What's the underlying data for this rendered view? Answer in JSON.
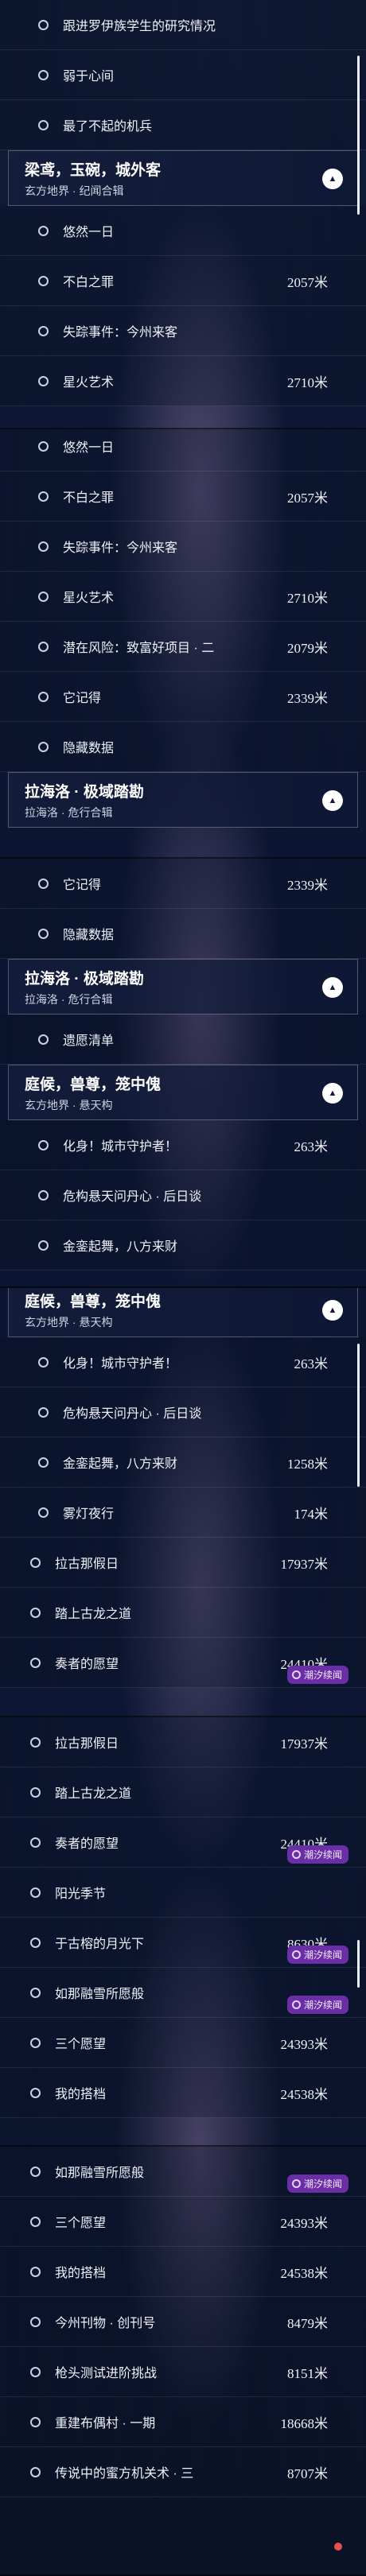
{
  "segments": [
    {
      "rows": [
        {
          "kind": "item",
          "indent": true,
          "label": "跟进罗伊族学生的研究情况"
        },
        {
          "kind": "item",
          "indent": true,
          "label": "弱于心间"
        },
        {
          "kind": "item",
          "indent": true,
          "label": "最了不起的机兵"
        },
        {
          "kind": "header",
          "title": "梁鸢，玉碗，城外客",
          "sub": "玄方地界 · 纪闻合辑"
        },
        {
          "kind": "item",
          "indent": true,
          "label": "悠然一日"
        },
        {
          "kind": "item",
          "indent": true,
          "label": "不白之罪",
          "dist": "2057米"
        },
        {
          "kind": "item",
          "indent": true,
          "label": "失踪事件：今州来客"
        },
        {
          "kind": "item",
          "indent": true,
          "label": "星火艺术",
          "dist": "2710米"
        }
      ]
    },
    {
      "rows": [
        {
          "kind": "item",
          "indent": true,
          "label": "悠然一日"
        },
        {
          "kind": "item",
          "indent": true,
          "label": "不白之罪",
          "dist": "2057米"
        },
        {
          "kind": "item",
          "indent": true,
          "label": "失踪事件：今州来客"
        },
        {
          "kind": "item",
          "indent": true,
          "label": "星火艺术",
          "dist": "2710米"
        },
        {
          "kind": "item",
          "indent": true,
          "label": "潜在风险：致富好项目 · 二",
          "dist": "2079米"
        },
        {
          "kind": "item",
          "indent": true,
          "label": "它记得",
          "dist": "2339米"
        },
        {
          "kind": "item",
          "indent": true,
          "label": "隐藏数据"
        },
        {
          "kind": "header",
          "title": "拉海洛 · 极域踏勘",
          "sub": "拉海洛 · 危行合辑"
        }
      ]
    },
    {
      "rows": [
        {
          "kind": "item",
          "indent": true,
          "label": "它记得",
          "dist": "2339米"
        },
        {
          "kind": "item",
          "indent": true,
          "label": "隐藏数据"
        },
        {
          "kind": "header",
          "title": "拉海洛 · 极域踏勘",
          "sub": "拉海洛 · 危行合辑"
        },
        {
          "kind": "item",
          "indent": true,
          "label": "遗愿清单"
        },
        {
          "kind": "header",
          "title": "庭候，兽尊，笼中傀",
          "sub": "玄方地界 · 悬天构"
        },
        {
          "kind": "item",
          "indent": true,
          "label": "化身！城市守护者！",
          "dist": "263米"
        },
        {
          "kind": "item",
          "indent": true,
          "label": "危构悬天问丹心 · 后日谈"
        },
        {
          "kind": "item",
          "indent": true,
          "label": "金銮起舞，八方来财"
        }
      ]
    },
    {
      "rows": [
        {
          "kind": "header",
          "title": "庭候，兽尊，笼中傀",
          "sub": "玄方地界 · 悬天构"
        },
        {
          "kind": "item",
          "indent": true,
          "label": "化身！城市守护者！",
          "dist": "263米"
        },
        {
          "kind": "item",
          "indent": true,
          "label": "危构悬天问丹心 · 后日谈"
        },
        {
          "kind": "item",
          "indent": true,
          "label": "金銮起舞，八方来财",
          "dist": "1258米"
        },
        {
          "kind": "item",
          "indent": true,
          "label": "雾灯夜行",
          "dist": "174米"
        },
        {
          "kind": "item",
          "indent": false,
          "label": "拉古那假日",
          "dist": "17937米"
        },
        {
          "kind": "item",
          "indent": false,
          "label": "踏上古龙之道"
        },
        {
          "kind": "item",
          "indent": false,
          "label": "奏者的愿望",
          "dist": "24410米",
          "badge": "潮汐续闻"
        }
      ]
    },
    {
      "rows": [
        {
          "kind": "item",
          "indent": false,
          "label": "拉古那假日",
          "dist": "17937米"
        },
        {
          "kind": "item",
          "indent": false,
          "label": "踏上古龙之道"
        },
        {
          "kind": "item",
          "indent": false,
          "label": "奏者的愿望",
          "dist": "24410米",
          "badge": "潮汐续闻"
        },
        {
          "kind": "item",
          "indent": false,
          "label": "阳光季节"
        },
        {
          "kind": "item",
          "indent": false,
          "label": "于古榕的月光下",
          "dist": "8630米",
          "badge": "潮汐续闻"
        },
        {
          "kind": "item",
          "indent": false,
          "label": "如那融雪所愿般",
          "badge": "潮汐续闻"
        },
        {
          "kind": "item",
          "indent": false,
          "label": "三个愿望",
          "dist": "24393米"
        },
        {
          "kind": "item",
          "indent": false,
          "label": "我的搭档",
          "dist": "24538米"
        }
      ]
    },
    {
      "rows": [
        {
          "kind": "item",
          "indent": false,
          "label": "如那融雪所愿般",
          "badge": "潮汐续闻"
        },
        {
          "kind": "item",
          "indent": false,
          "label": "三个愿望",
          "dist": "24393米"
        },
        {
          "kind": "item",
          "indent": false,
          "label": "我的搭档",
          "dist": "24538米"
        },
        {
          "kind": "item",
          "indent": false,
          "label": "今州刊物 · 创刊号",
          "dist": "8479米"
        },
        {
          "kind": "item",
          "indent": false,
          "label": "枪头测试进阶挑战",
          "dist": "8151米"
        },
        {
          "kind": "item",
          "indent": false,
          "label": "重建布偶村 · 一期",
          "dist": "18668米"
        },
        {
          "kind": "item",
          "indent": false,
          "label": "传说中的蜜方机关术 · 三",
          "dist": "8707米"
        }
      ]
    }
  ],
  "icons": {
    "item": "circle-icon",
    "header": "chevron-up-icon",
    "badge": "tide-icon"
  },
  "colors": {
    "badge": "#6a2fa6",
    "background": "#0a1226",
    "header_border": "#ffffffa0"
  }
}
